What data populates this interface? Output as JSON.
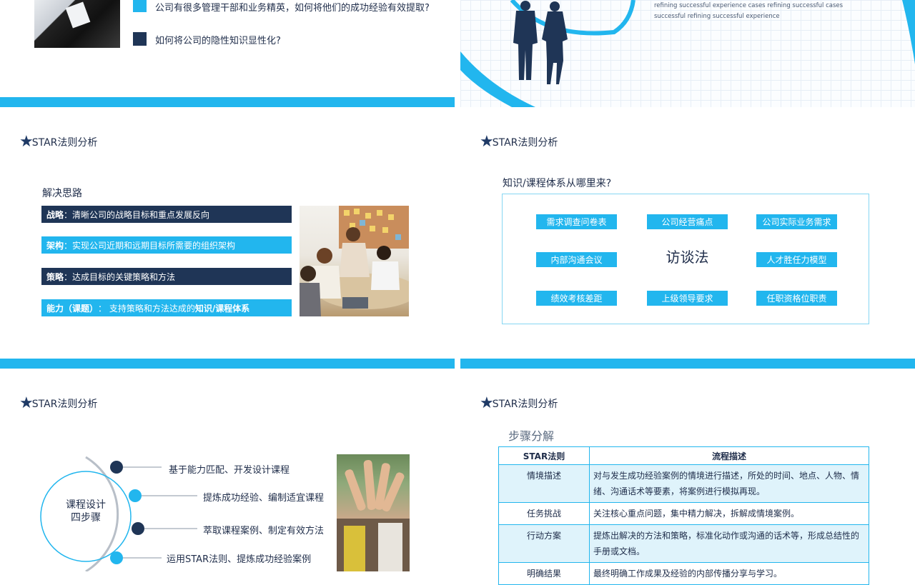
{
  "slide1": {
    "questions": [
      "公司有很多管理干部和业务精英，如何将他们的成功经验有效提取?",
      "如何将公司的隐性知识显性化?"
    ]
  },
  "slide2": {
    "english_lines": [
      "refining successful experience cases refining successful cases",
      "successful refining successful experience"
    ]
  },
  "slide3": {
    "section_title": "STAR法则分析",
    "heading": "解决思路",
    "items": [
      {
        "key": "战略",
        "text": "：清晰公司的战略目标和重点发展反向"
      },
      {
        "key": "架构",
        "text": "：实现公司近期和远期目标所需要的组织架构"
      },
      {
        "key": "策略",
        "text": "：达成目标的关键策略和方法"
      },
      {
        "key": "能力（课题）",
        "text": "： 支持策略和方法达成的",
        "emph": "知识/课程体系"
      }
    ]
  },
  "slide4": {
    "section_title": "STAR法则分析",
    "question": "知识/课程体系从哪里来?",
    "center": "访谈法",
    "sources": [
      "需求调查问卷表",
      "公司经营痛点",
      "公司实际业务需求",
      "内部沟通会议",
      "人才胜任力模型",
      "绩效考核差距",
      "上级领导要求",
      "任职资格位职责"
    ]
  },
  "slide5": {
    "section_title": "STAR法则分析",
    "circle_line1": "课程设计",
    "circle_line2": "四步骤",
    "steps": [
      "基于能力匹配、开发设计课程",
      "提炼成功经验、编制适宜课程",
      "萃取课程案例、制定有效方法",
      "运用STAR法则、提炼成功经验案例"
    ]
  },
  "slide6": {
    "section_title": "STAR法则分析",
    "heading": "步骤分解",
    "table": {
      "headers": [
        "STAR法则",
        "流程描述"
      ],
      "rows": [
        [
          "情境描述",
          "对与发生成功经验案例的情境进行描述，所处的时间、地点、人物、情绪、沟通话术等要素，将案例进行模拟再现。"
        ],
        [
          "任务挑战",
          "关注核心重点问题，集中精力解决，拆解成情境案例。"
        ],
        [
          "行动方案",
          "提炼出解决的方法和策略，标准化动作或沟通的话术等，形成总结性的手册或文档。"
        ],
        [
          "明确结果",
          "最终明确工作成果及经验的内部传播分享与学习。"
        ]
      ]
    }
  },
  "colors": {
    "accent": "#22b6ee",
    "navy": "#1f3556"
  }
}
